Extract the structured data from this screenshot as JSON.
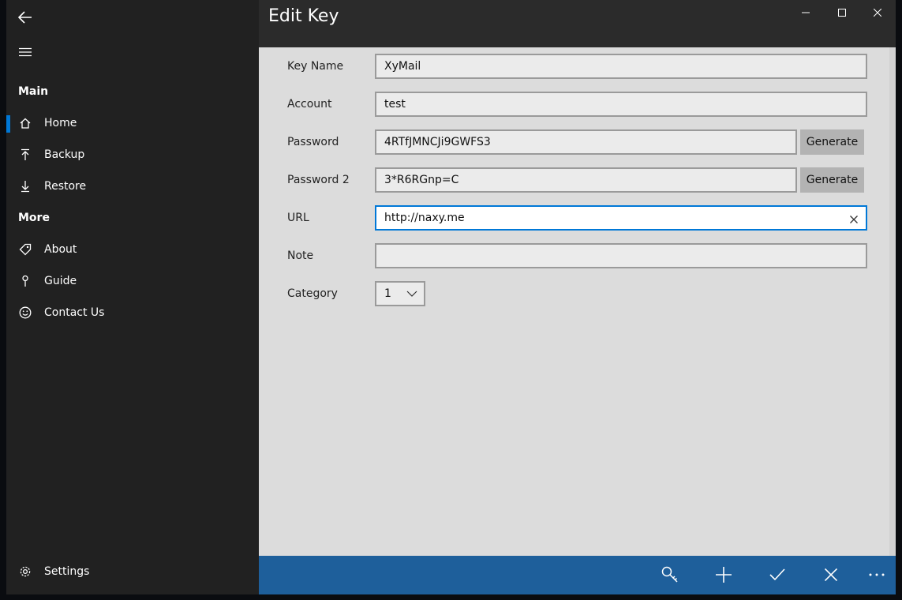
{
  "window": {
    "title": "Edit Key"
  },
  "sidebar": {
    "sections": [
      {
        "label": "Main"
      },
      {
        "label": "More"
      }
    ],
    "items": [
      {
        "label": "Home",
        "icon": "home-icon",
        "selected": true
      },
      {
        "label": "Backup",
        "icon": "upload-icon"
      },
      {
        "label": "Restore",
        "icon": "download-icon"
      },
      {
        "label": "About",
        "icon": "tag-icon"
      },
      {
        "label": "Guide",
        "icon": "pin-icon"
      },
      {
        "label": "Contact Us",
        "icon": "smiley-icon"
      }
    ],
    "settings_label": "Settings"
  },
  "form": {
    "key_name": {
      "label": "Key Name",
      "value": "XyMail"
    },
    "account": {
      "label": "Account",
      "value": "test"
    },
    "password": {
      "label": "Password",
      "value": "4RTfJMNCJi9GWFS3",
      "button": "Generate"
    },
    "password2": {
      "label": "Password 2",
      "value": "3*R6RGnp=C",
      "button": "Generate"
    },
    "url": {
      "label": "URL",
      "value": "http://naxy.me"
    },
    "note": {
      "label": "Note",
      "value": ""
    },
    "category": {
      "label": "Category",
      "value": "1"
    }
  },
  "colors": {
    "accent": "#0078d7",
    "command_bar": "#1e5f9b",
    "sidebar_bg": "#212121",
    "content_bg": "#dcdcdc"
  },
  "commandbar": {
    "buttons": [
      "key-search-icon",
      "add-icon",
      "checkmark-icon",
      "close-icon",
      "more-icon"
    ]
  }
}
